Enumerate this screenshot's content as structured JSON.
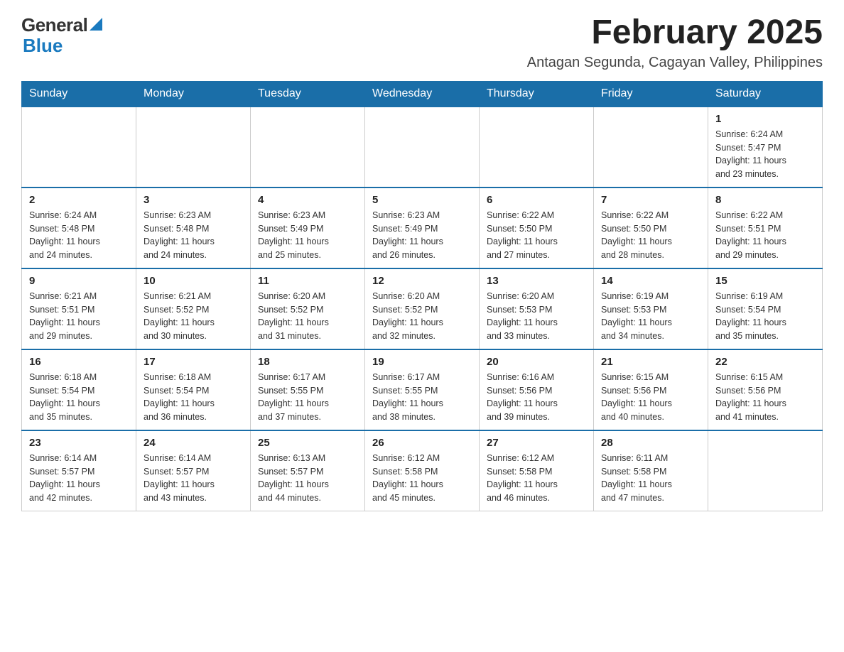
{
  "logo": {
    "general": "General",
    "blue": "Blue",
    "arrow_color": "#1a7abf"
  },
  "header": {
    "month_title": "February 2025",
    "subtitle": "Antagan Segunda, Cagayan Valley, Philippines"
  },
  "weekdays": [
    "Sunday",
    "Monday",
    "Tuesday",
    "Wednesday",
    "Thursday",
    "Friday",
    "Saturday"
  ],
  "weeks": [
    {
      "days": [
        {
          "number": "",
          "info": ""
        },
        {
          "number": "",
          "info": ""
        },
        {
          "number": "",
          "info": ""
        },
        {
          "number": "",
          "info": ""
        },
        {
          "number": "",
          "info": ""
        },
        {
          "number": "",
          "info": ""
        },
        {
          "number": "1",
          "info": "Sunrise: 6:24 AM\nSunset: 5:47 PM\nDaylight: 11 hours\nand 23 minutes."
        }
      ]
    },
    {
      "days": [
        {
          "number": "2",
          "info": "Sunrise: 6:24 AM\nSunset: 5:48 PM\nDaylight: 11 hours\nand 24 minutes."
        },
        {
          "number": "3",
          "info": "Sunrise: 6:23 AM\nSunset: 5:48 PM\nDaylight: 11 hours\nand 24 minutes."
        },
        {
          "number": "4",
          "info": "Sunrise: 6:23 AM\nSunset: 5:49 PM\nDaylight: 11 hours\nand 25 minutes."
        },
        {
          "number": "5",
          "info": "Sunrise: 6:23 AM\nSunset: 5:49 PM\nDaylight: 11 hours\nand 26 minutes."
        },
        {
          "number": "6",
          "info": "Sunrise: 6:22 AM\nSunset: 5:50 PM\nDaylight: 11 hours\nand 27 minutes."
        },
        {
          "number": "7",
          "info": "Sunrise: 6:22 AM\nSunset: 5:50 PM\nDaylight: 11 hours\nand 28 minutes."
        },
        {
          "number": "8",
          "info": "Sunrise: 6:22 AM\nSunset: 5:51 PM\nDaylight: 11 hours\nand 29 minutes."
        }
      ]
    },
    {
      "days": [
        {
          "number": "9",
          "info": "Sunrise: 6:21 AM\nSunset: 5:51 PM\nDaylight: 11 hours\nand 29 minutes."
        },
        {
          "number": "10",
          "info": "Sunrise: 6:21 AM\nSunset: 5:52 PM\nDaylight: 11 hours\nand 30 minutes."
        },
        {
          "number": "11",
          "info": "Sunrise: 6:20 AM\nSunset: 5:52 PM\nDaylight: 11 hours\nand 31 minutes."
        },
        {
          "number": "12",
          "info": "Sunrise: 6:20 AM\nSunset: 5:52 PM\nDaylight: 11 hours\nand 32 minutes."
        },
        {
          "number": "13",
          "info": "Sunrise: 6:20 AM\nSunset: 5:53 PM\nDaylight: 11 hours\nand 33 minutes."
        },
        {
          "number": "14",
          "info": "Sunrise: 6:19 AM\nSunset: 5:53 PM\nDaylight: 11 hours\nand 34 minutes."
        },
        {
          "number": "15",
          "info": "Sunrise: 6:19 AM\nSunset: 5:54 PM\nDaylight: 11 hours\nand 35 minutes."
        }
      ]
    },
    {
      "days": [
        {
          "number": "16",
          "info": "Sunrise: 6:18 AM\nSunset: 5:54 PM\nDaylight: 11 hours\nand 35 minutes."
        },
        {
          "number": "17",
          "info": "Sunrise: 6:18 AM\nSunset: 5:54 PM\nDaylight: 11 hours\nand 36 minutes."
        },
        {
          "number": "18",
          "info": "Sunrise: 6:17 AM\nSunset: 5:55 PM\nDaylight: 11 hours\nand 37 minutes."
        },
        {
          "number": "19",
          "info": "Sunrise: 6:17 AM\nSunset: 5:55 PM\nDaylight: 11 hours\nand 38 minutes."
        },
        {
          "number": "20",
          "info": "Sunrise: 6:16 AM\nSunset: 5:56 PM\nDaylight: 11 hours\nand 39 minutes."
        },
        {
          "number": "21",
          "info": "Sunrise: 6:15 AM\nSunset: 5:56 PM\nDaylight: 11 hours\nand 40 minutes."
        },
        {
          "number": "22",
          "info": "Sunrise: 6:15 AM\nSunset: 5:56 PM\nDaylight: 11 hours\nand 41 minutes."
        }
      ]
    },
    {
      "days": [
        {
          "number": "23",
          "info": "Sunrise: 6:14 AM\nSunset: 5:57 PM\nDaylight: 11 hours\nand 42 minutes."
        },
        {
          "number": "24",
          "info": "Sunrise: 6:14 AM\nSunset: 5:57 PM\nDaylight: 11 hours\nand 43 minutes."
        },
        {
          "number": "25",
          "info": "Sunrise: 6:13 AM\nSunset: 5:57 PM\nDaylight: 11 hours\nand 44 minutes."
        },
        {
          "number": "26",
          "info": "Sunrise: 6:12 AM\nSunset: 5:58 PM\nDaylight: 11 hours\nand 45 minutes."
        },
        {
          "number": "27",
          "info": "Sunrise: 6:12 AM\nSunset: 5:58 PM\nDaylight: 11 hours\nand 46 minutes."
        },
        {
          "number": "28",
          "info": "Sunrise: 6:11 AM\nSunset: 5:58 PM\nDaylight: 11 hours\nand 47 minutes."
        },
        {
          "number": "",
          "info": ""
        }
      ]
    }
  ]
}
